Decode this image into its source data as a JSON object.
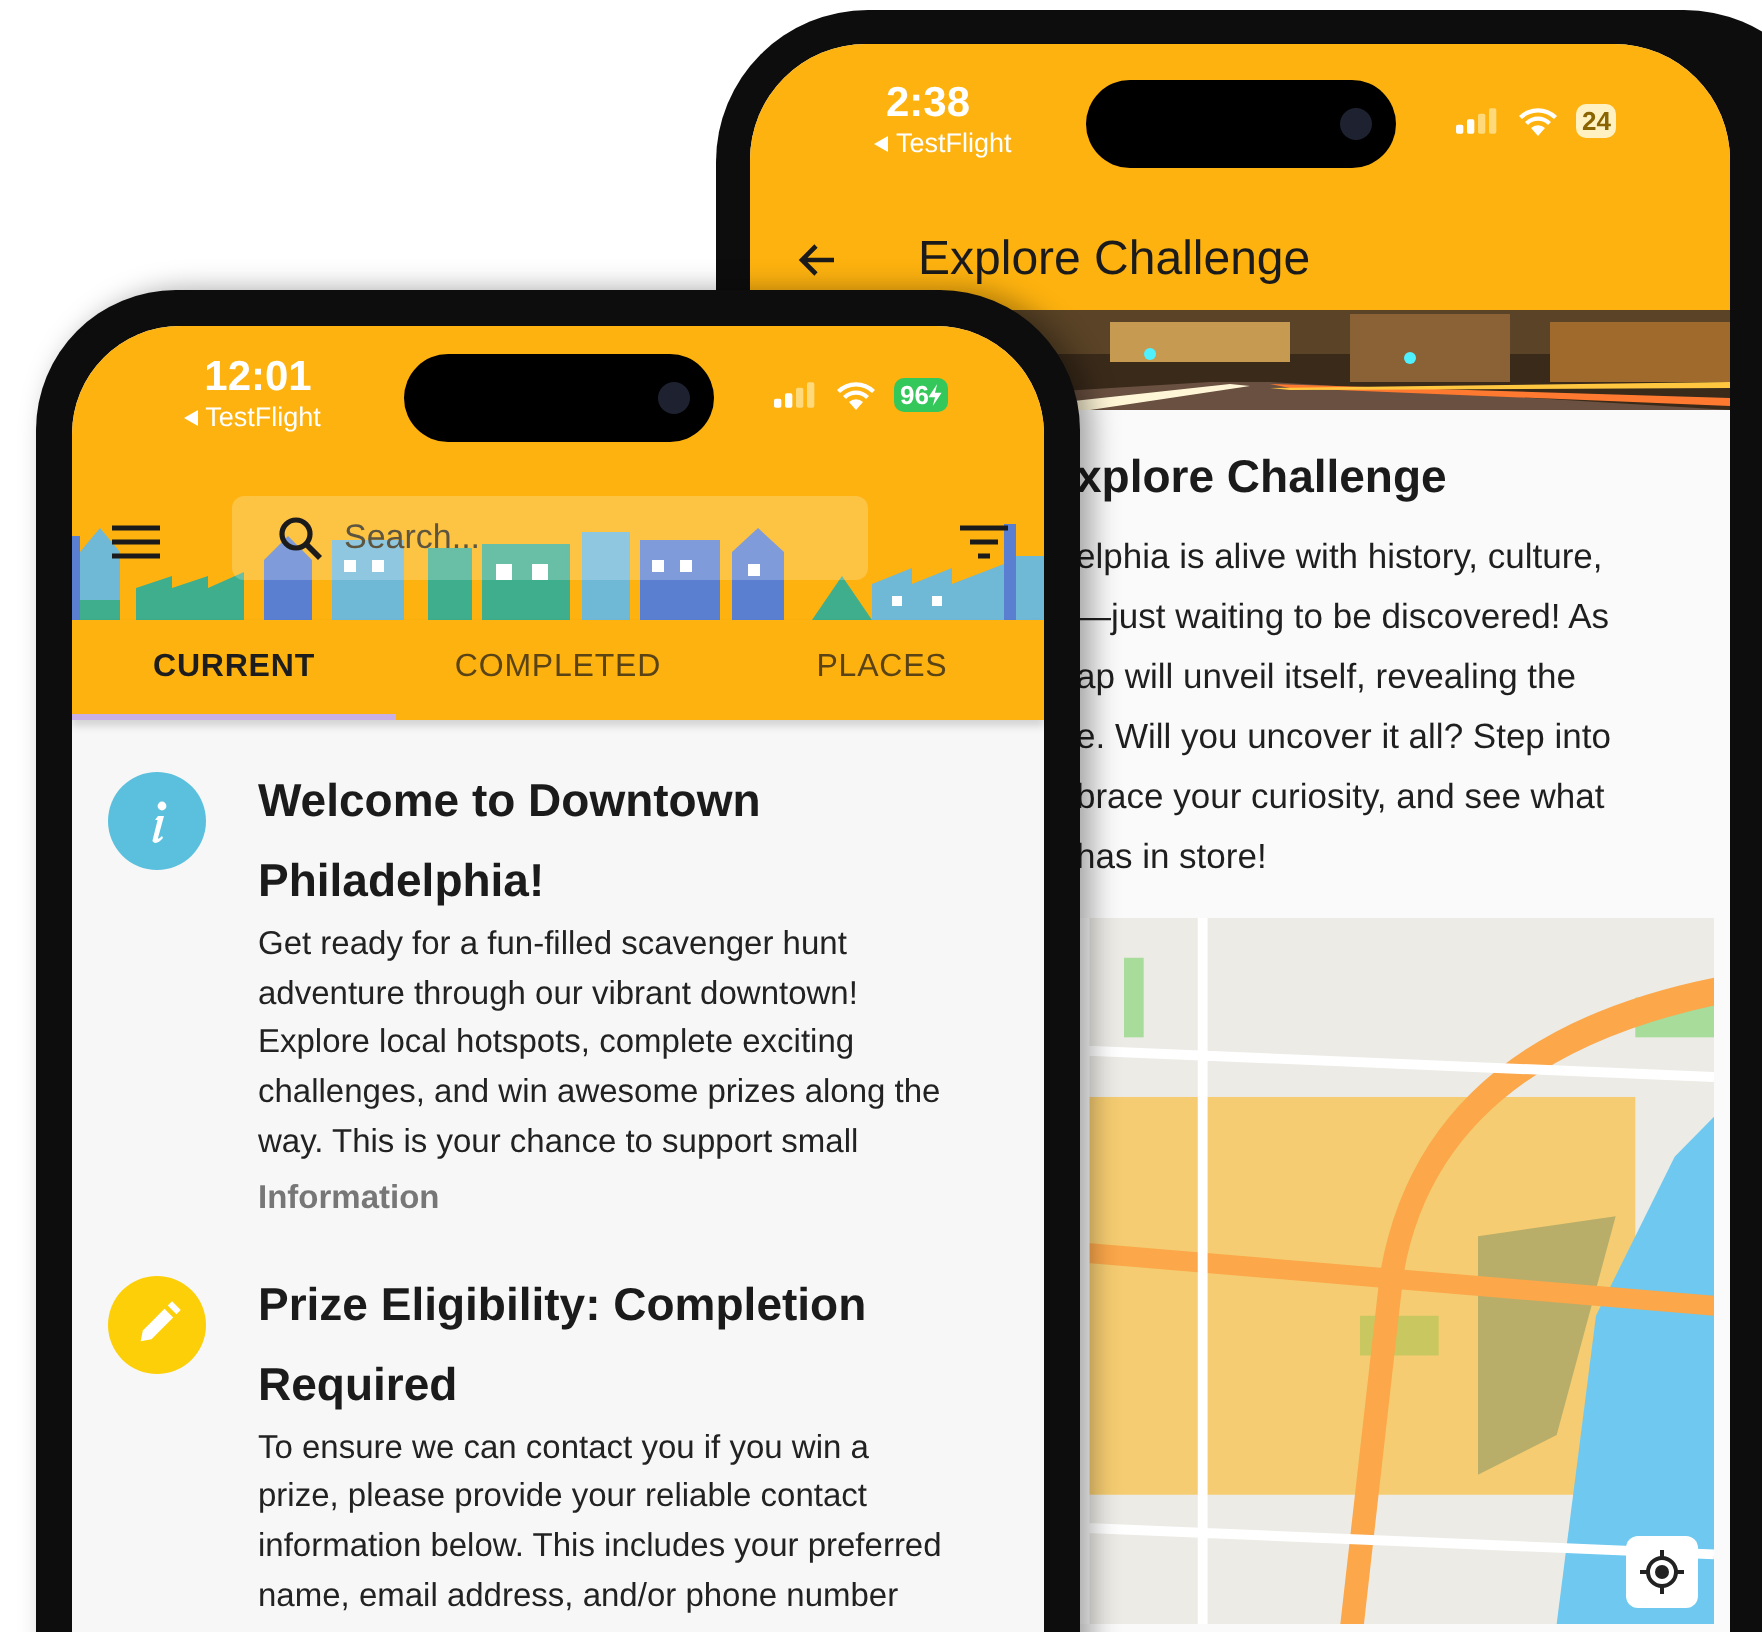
{
  "back_phone": {
    "status_bar": {
      "time": "2:38",
      "back_link": "TestFlight",
      "battery": "24",
      "charging": false
    },
    "app_bar": {
      "title": "Explore Challenge"
    },
    "heading": "xplore Challenge",
    "paragraph_lines": [
      "elphia is alive with history, culture,",
      "—just waiting to be discovered! As",
      "ap will unveil itself, revealing the",
      "e. Will you uncover it all? Step into",
      "brace your curiosity, and see what",
      "has in store!"
    ]
  },
  "front_phone": {
    "status_bar": {
      "time": "12:01",
      "back_link": "TestFlight",
      "battery": "96",
      "charging": true
    },
    "search": {
      "placeholder": "Search..."
    },
    "tabs": [
      {
        "label": "CURRENT",
        "selected": true
      },
      {
        "label": "COMPLETED",
        "selected": false
      },
      {
        "label": "PLACES",
        "selected": false
      }
    ],
    "cards": [
      {
        "kind": "info",
        "title": "Welcome to Downtown Philadelphia!",
        "lines": [
          "Get ready for a fun-filled scavenger hunt",
          "adventure through our vibrant downtown!",
          "Explore local hotspots, complete exciting",
          "challenges, and win awesome prizes along the",
          "way. This is your chance to support small"
        ],
        "link": "Information"
      },
      {
        "kind": "edit",
        "title": "Prize Eligibility: Completion Required",
        "lines": [
          "To ensure we can contact you if you win a",
          "prize, please provide your reliable contact",
          "information below. This includes your preferred",
          "name, email address, and/or phone number"
        ]
      }
    ]
  }
}
